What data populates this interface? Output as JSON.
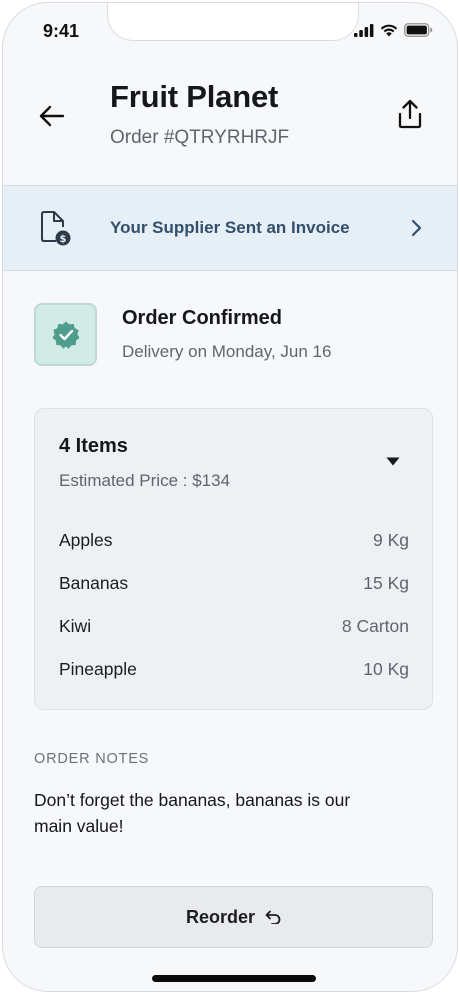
{
  "status_bar": {
    "time": "9:41"
  },
  "header": {
    "title": "Fruit Planet",
    "order_id": "Order #QTRYRHRJF"
  },
  "invoice_banner": {
    "text": "Your Supplier Sent an Invoice"
  },
  "order_status": {
    "title": "Order Confirmed",
    "subtitle": "Delivery on Monday, Jun 16"
  },
  "items": {
    "count_label": "4 Items",
    "estimated_price": "Estimated Price : $134",
    "rows": [
      {
        "name": "Apples",
        "qty": "9 Kg"
      },
      {
        "name": "Bananas",
        "qty": "15 Kg"
      },
      {
        "name": "Kiwi",
        "qty": "8 Carton"
      },
      {
        "name": "Pineapple",
        "qty": "10 Kg"
      }
    ]
  },
  "notes": {
    "heading": "ORDER NOTES",
    "text": "Don’t forget the bananas, bananas is our main value!"
  },
  "reorder": {
    "label": "Reorder"
  },
  "colors": {
    "banner_bg": "#e6eef6",
    "banner_text": "#33506b",
    "confirmed_badge": "#4f9d8d"
  },
  "icons": [
    "back-arrow-icon",
    "share-icon",
    "invoice-icon",
    "chevron-right-icon",
    "verified-badge-icon",
    "caret-down-icon",
    "undo-icon"
  ]
}
